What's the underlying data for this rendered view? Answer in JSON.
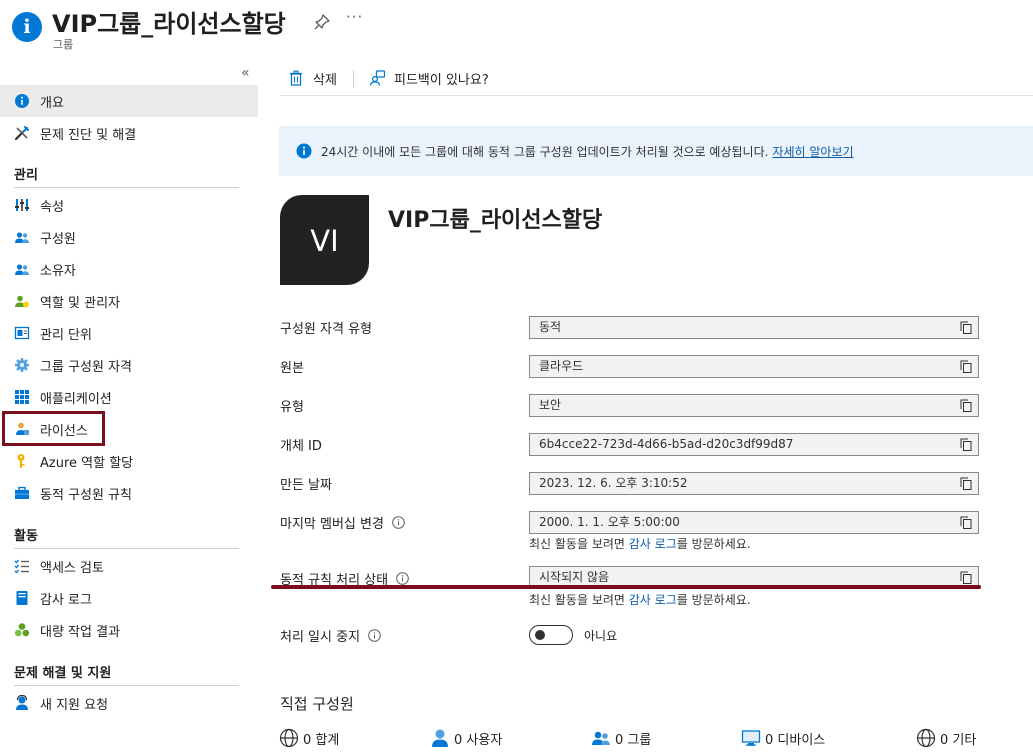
{
  "header": {
    "title": "VIP그룹_라이선스할당",
    "subtitle": "그룹",
    "more": "···"
  },
  "sidebar": {
    "collapse": "«",
    "top_items": [
      {
        "label": "개요",
        "icon": "info-icon",
        "active": true
      },
      {
        "label": "문제 진단 및 해결",
        "icon": "wrench-icon",
        "active": false
      }
    ],
    "sections": [
      {
        "title": "관리",
        "items": [
          {
            "label": "속성",
            "icon": "properties-icon"
          },
          {
            "label": "구성원",
            "icon": "members-icon"
          },
          {
            "label": "소유자",
            "icon": "owners-icon"
          },
          {
            "label": "역할 및 관리자",
            "icon": "roles-icon"
          },
          {
            "label": "관리 단위",
            "icon": "admin-units-icon"
          },
          {
            "label": "그룹 구성원 자격",
            "icon": "gear-icon"
          },
          {
            "label": "애플리케이션",
            "icon": "grid-icon"
          },
          {
            "label": "라이선스",
            "icon": "license-icon"
          },
          {
            "label": "Azure 역할 할당",
            "icon": "key-icon"
          },
          {
            "label": "동적 구성원 규칙",
            "icon": "toolbox-icon"
          }
        ]
      },
      {
        "title": "활동",
        "items": [
          {
            "label": "액세스 검토",
            "icon": "checklist-icon"
          },
          {
            "label": "감사 로그",
            "icon": "log-icon"
          },
          {
            "label": "대량 작업 결과",
            "icon": "bulk-icon"
          }
        ]
      },
      {
        "title": "문제 해결 및 지원",
        "items": [
          {
            "label": "새 지원 요청",
            "icon": "support-icon"
          }
        ]
      }
    ]
  },
  "toolbar": {
    "delete_label": "삭제",
    "feedback_label": "피드백이 있나요?"
  },
  "banner": {
    "text": "24시간 이내에 모든 그룹에 대해 동적 그룹 구성원 업데이트가 처리될 것으로 예상됩니다.",
    "link": "자세히 알아보기"
  },
  "group": {
    "avatar_text": "VI",
    "name": "VIP그룹_라이선스할당"
  },
  "properties": [
    {
      "label": "구성원 자격 유형",
      "value": "동적"
    },
    {
      "label": "원본",
      "value": "클라우드"
    },
    {
      "label": "유형",
      "value": "보안"
    },
    {
      "label": "개체 ID",
      "value": "6b4cce22-723d-4d66-b5ad-d20c3df99d87"
    },
    {
      "label": "만든 날짜",
      "value": "2023. 12. 6. 오후 3:10:52"
    },
    {
      "label": "마지막 멤버십 변경",
      "value": "2000. 1. 1. 오후 5:00:00"
    },
    {
      "label": "동적 규칙 처리 상태",
      "value": "시작되지 않음"
    }
  ],
  "hint": {
    "prefix": "최신 활동을 보려면 ",
    "link": "감사 로그",
    "suffix": "를 방문하세요."
  },
  "pause": {
    "label": "처리 일시 중지",
    "value": "아니요",
    "enabled": false
  },
  "members": {
    "title": "직접 구성원",
    "stats": [
      {
        "text": "0 합계",
        "icon": "globe-icon"
      },
      {
        "text": "0 사용자",
        "icon": "user-icon"
      },
      {
        "text": "0 그룹",
        "icon": "group-icon"
      },
      {
        "text": "0 디바이스",
        "icon": "device-icon"
      },
      {
        "text": "0 기타",
        "icon": "globe-icon"
      }
    ]
  },
  "colors": {
    "accent": "#0078d4",
    "highlight": "#7a0e1f",
    "banner_bg": "#eaf2fb",
    "link": "#0f5ca8"
  }
}
